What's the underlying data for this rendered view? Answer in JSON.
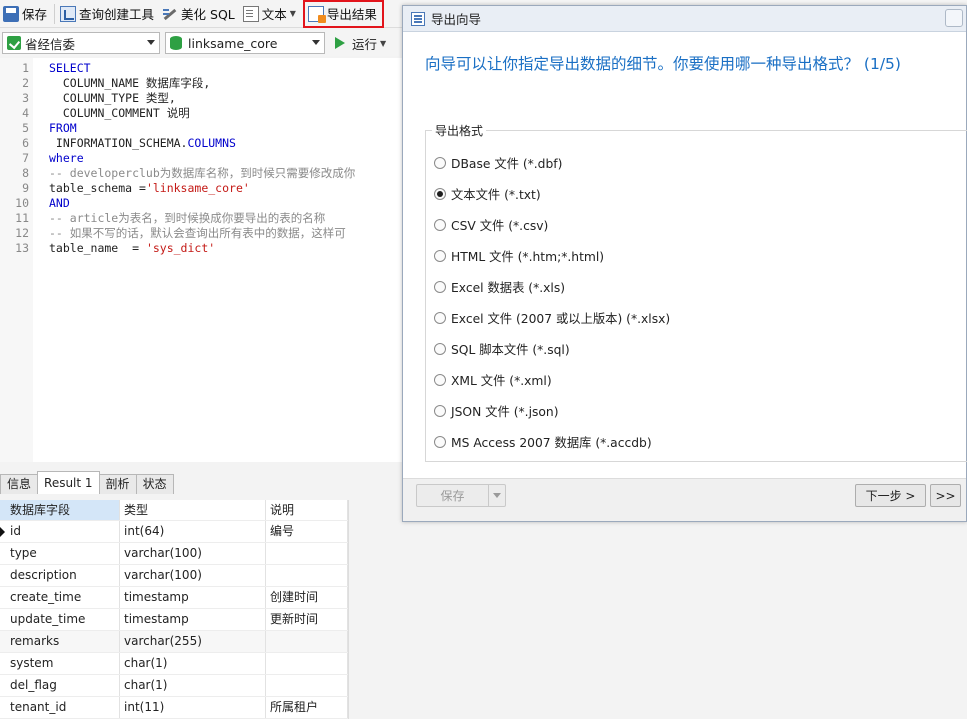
{
  "toolbar": {
    "save": "保存",
    "query_builder": "查询创建工具",
    "beautify_sql": "美化 SQL",
    "text": "文本",
    "export_result": "导出结果"
  },
  "toolbar2": {
    "connection": "省经信委",
    "database": "linksame_core",
    "run": "运行"
  },
  "editor": {
    "lines": [
      "SELECT",
      "  COLUMN_NAME 数据库字段,",
      "  COLUMN_TYPE 类型,",
      "  COLUMN_COMMENT 说明",
      "FROM",
      " INFORMATION_SCHEMA.",
      "where",
      "-- developerclub为数据库名称，到时候只需要修改成你",
      "table_schema =",
      "AND",
      "-- article为表名，到时候换成你要导出的表的名称",
      "-- 如果不写的话，默认会查询出所有表中的数据，这样可",
      "table_name  = "
    ],
    "columns_kw": "COLUMNS",
    "schema_str": "'linksame_core'",
    "table_str": "'sys_dict'"
  },
  "result_tabs": [
    "信息",
    "Result 1",
    "剖析",
    "状态"
  ],
  "grid": {
    "headers": [
      "数据库字段",
      "类型",
      "说明"
    ],
    "rows": [
      [
        "id",
        "int(64)",
        "编号"
      ],
      [
        "type",
        "varchar(100)",
        ""
      ],
      [
        "description",
        "varchar(100)",
        ""
      ],
      [
        "create_time",
        "timestamp",
        "创建时间"
      ],
      [
        "update_time",
        "timestamp",
        "更新时间"
      ],
      [
        "remarks",
        "varchar(255)",
        ""
      ],
      [
        "system",
        "char(1)",
        ""
      ],
      [
        "del_flag",
        "char(1)",
        ""
      ],
      [
        "tenant_id",
        "int(11)",
        "所属租户"
      ]
    ]
  },
  "dialog": {
    "title": "导出向导",
    "heading": "向导可以让你指定导出数据的细节。你要使用哪一种导出格式？ (1/5)",
    "group_label": "导出格式",
    "formats": [
      "DBase 文件 (*.dbf)",
      "文本文件 (*.txt)",
      "CSV 文件 (*.csv)",
      "HTML 文件 (*.htm;*.html)",
      "Excel 数据表 (*.xls)",
      "Excel 文件 (2007 或以上版本) (*.xlsx)",
      "SQL 脚本文件 (*.sql)",
      "XML 文件 (*.xml)",
      "JSON 文件 (*.json)",
      "MS Access 2007 数据库 (*.accdb)"
    ],
    "selected_format": "文本文件 (*.txt)",
    "save_button": "保存",
    "next_button": "下一步 >",
    "last_button": ">>"
  }
}
